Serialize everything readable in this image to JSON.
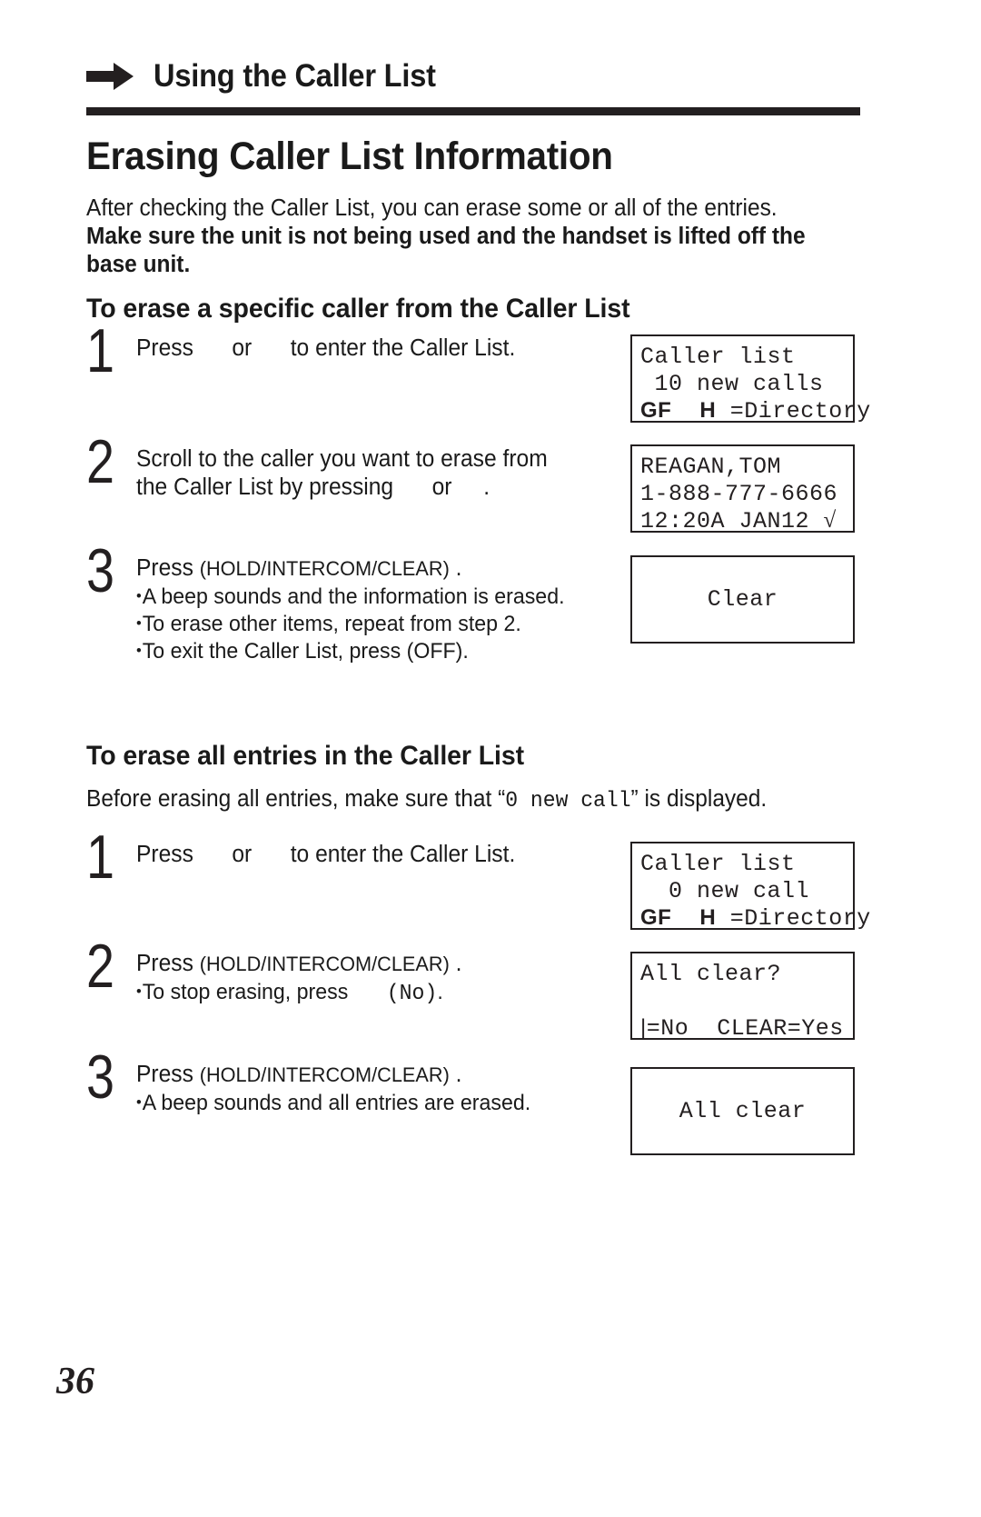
{
  "runhead": {
    "arrow_icon": "right-arrow-icon",
    "title": "Using the Caller List"
  },
  "section": {
    "title": "Erasing Caller List Information",
    "intro_line1": "After checking the Caller List, you can erase some or all of the entries.",
    "intro_line2": "Make sure the unit is not being used and the handset is lifted off the",
    "intro_line3": "base unit."
  },
  "subsection_specific": {
    "heading": "To erase a specific caller from the Caller List",
    "steps": [
      {
        "number": "1",
        "line1_a": "Press",
        "line1_b": "or",
        "line1_c": "to enter the Caller List."
      },
      {
        "number": "2",
        "line1": "Scroll to the caller you want to erase from",
        "line2_a": "the Caller List by pressing",
        "line2_b": "or",
        "line2_c": "."
      },
      {
        "number": "3",
        "line1_a": "Press",
        "line1_b": "(HOLD/INTERCOM/CLEAR)",
        "line1_c": ".",
        "bullets": [
          "A beep sounds and the information is erased.",
          "To erase other items, repeat from step 2.",
          "To exit the Caller List, press (OFF)."
        ]
      }
    ],
    "displays": [
      {
        "name": "caller-list-10-new-calls",
        "line1": "Caller list",
        "line2": " 10 new calls",
        "line3_sym1": "GF",
        "line3_mid": "  ",
        "line3_sym2": "H",
        "line3_text": " =Directory"
      },
      {
        "name": "caller-detail",
        "line1": "REAGAN,TOM",
        "line2": "1-888-777-6666",
        "line3": "12:20A JAN12 ",
        "line3_check": "√"
      },
      {
        "name": "clear-confirmation",
        "line1": "Clear"
      }
    ]
  },
  "subsection_all": {
    "heading": "To erase all entries in the Caller List",
    "before_text_a": "Before erasing all entries, make sure that “",
    "before_mono": "0 new call",
    "before_text_b": "” is displayed.",
    "steps": [
      {
        "number": "1",
        "line1_a": "Press",
        "line1_b": "or",
        "line1_c": "to enter the Caller List."
      },
      {
        "number": "2",
        "line1_a": "Press",
        "line1_b": "(HOLD/INTERCOM/CLEAR)",
        "line1_c": ".",
        "bullet_a": "To stop erasing, press",
        "bullet_mono": "(No)",
        "bullet_b": "."
      },
      {
        "number": "3",
        "line1_a": "Press",
        "line1_b": "(HOLD/INTERCOM/CLEAR)",
        "line1_c": ".",
        "bullets": [
          "A beep sounds and all entries are erased."
        ]
      }
    ],
    "displays": [
      {
        "name": "caller-list-0-new-call",
        "line1": "Caller list",
        "line2": "  0 new call",
        "line3_sym1": "GF",
        "line3_mid": "  ",
        "line3_sym2": "H",
        "line3_text": " =Directory"
      },
      {
        "name": "all-clear-prompt",
        "line1": "All clear?",
        "line3_bar": "|",
        "line3_text": "=No  CLEAR=Yes"
      },
      {
        "name": "all-clear-done",
        "line1": "All clear"
      }
    ]
  },
  "footer": {
    "page_number": "36"
  },
  "colors": {
    "ink": "#231f20",
    "paper": "#ffffff"
  }
}
